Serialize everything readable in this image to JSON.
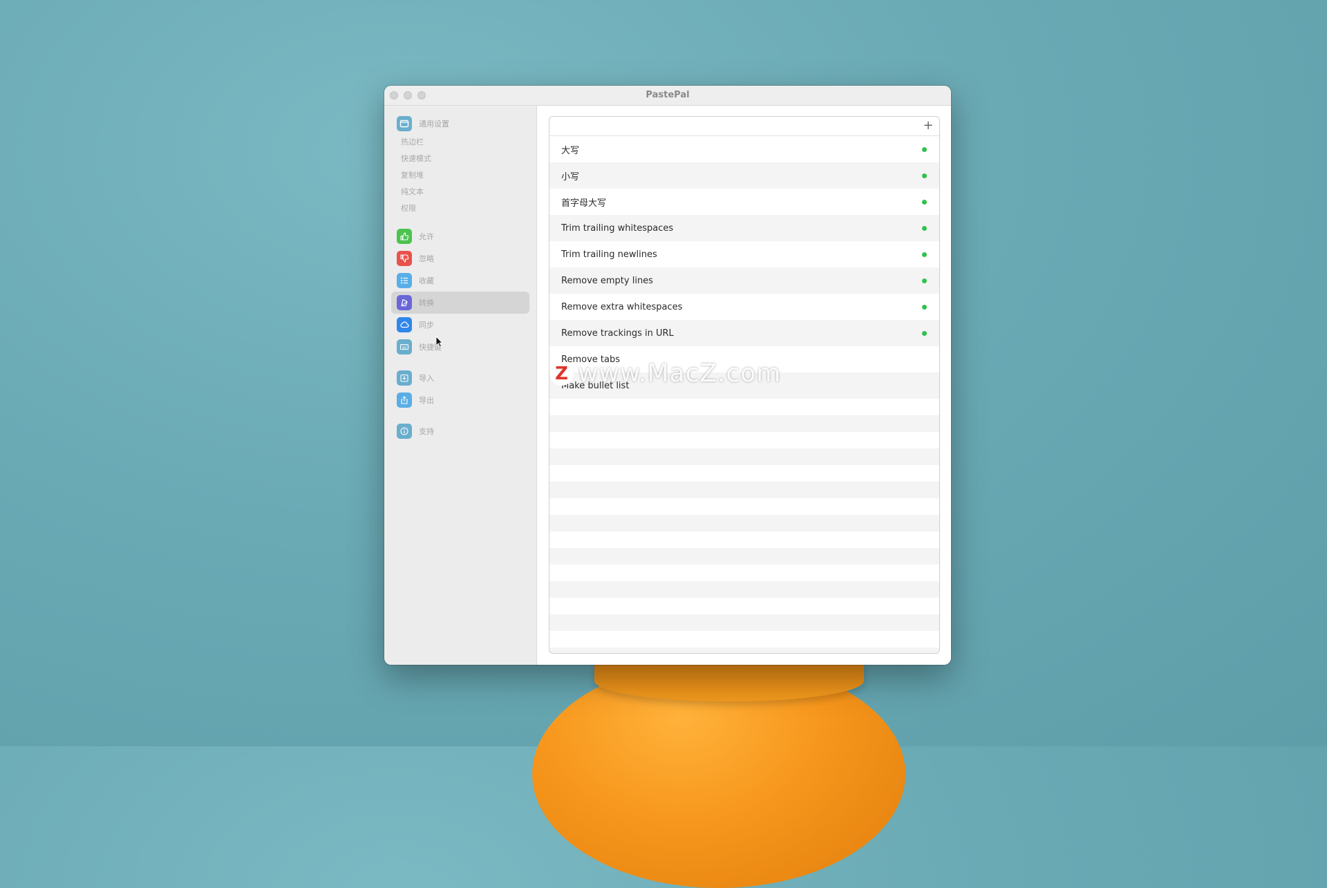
{
  "window": {
    "title": "PastePal"
  },
  "sidebar": {
    "general": {
      "label": "通用设置",
      "icon": "window-icon",
      "color": "#6aaecd"
    },
    "sub_items": [
      "热边栏",
      "快速模式",
      "复制堆",
      "纯文本",
      "权限"
    ],
    "items": [
      {
        "label": "允许",
        "icon": "thumbs-up-icon",
        "color": "#4cc34f"
      },
      {
        "label": "忽略",
        "icon": "thumbs-down-icon",
        "color": "#e8524a"
      },
      {
        "label": "收藏",
        "icon": "list-icon",
        "color": "#5aaee6"
      },
      {
        "label": "转换",
        "icon": "transform-icon",
        "color": "#6b66d8",
        "selected": true
      },
      {
        "label": "同步",
        "icon": "cloud-icon",
        "color": "#2f86e8"
      },
      {
        "label": "快捷键",
        "icon": "keyboard-icon",
        "color": "#6aaecd"
      }
    ],
    "io_items": [
      {
        "label": "导入",
        "icon": "import-icon",
        "color": "#6aaecd"
      },
      {
        "label": "导出",
        "icon": "export-icon",
        "color": "#5aaee6"
      }
    ],
    "support": {
      "label": "支持",
      "icon": "info-icon",
      "color": "#6aaecd"
    }
  },
  "transforms": {
    "add_label": "+",
    "status_color": "#2fc24b",
    "rows": [
      {
        "label": "大写",
        "enabled": true
      },
      {
        "label": "小写",
        "enabled": true
      },
      {
        "label": "首字母大写",
        "enabled": true
      },
      {
        "label": "Trim trailing whitespaces",
        "enabled": true
      },
      {
        "label": "Trim trailing newlines",
        "enabled": true
      },
      {
        "label": "Remove empty lines",
        "enabled": true
      },
      {
        "label": "Remove extra whitespaces",
        "enabled": true
      },
      {
        "label": "Remove trackings in URL",
        "enabled": true
      },
      {
        "label": "Remove tabs",
        "enabled": false
      },
      {
        "label": "Make bullet list",
        "enabled": false
      }
    ]
  },
  "watermark": {
    "logo": "Z",
    "text": "www.MacZ.com"
  }
}
